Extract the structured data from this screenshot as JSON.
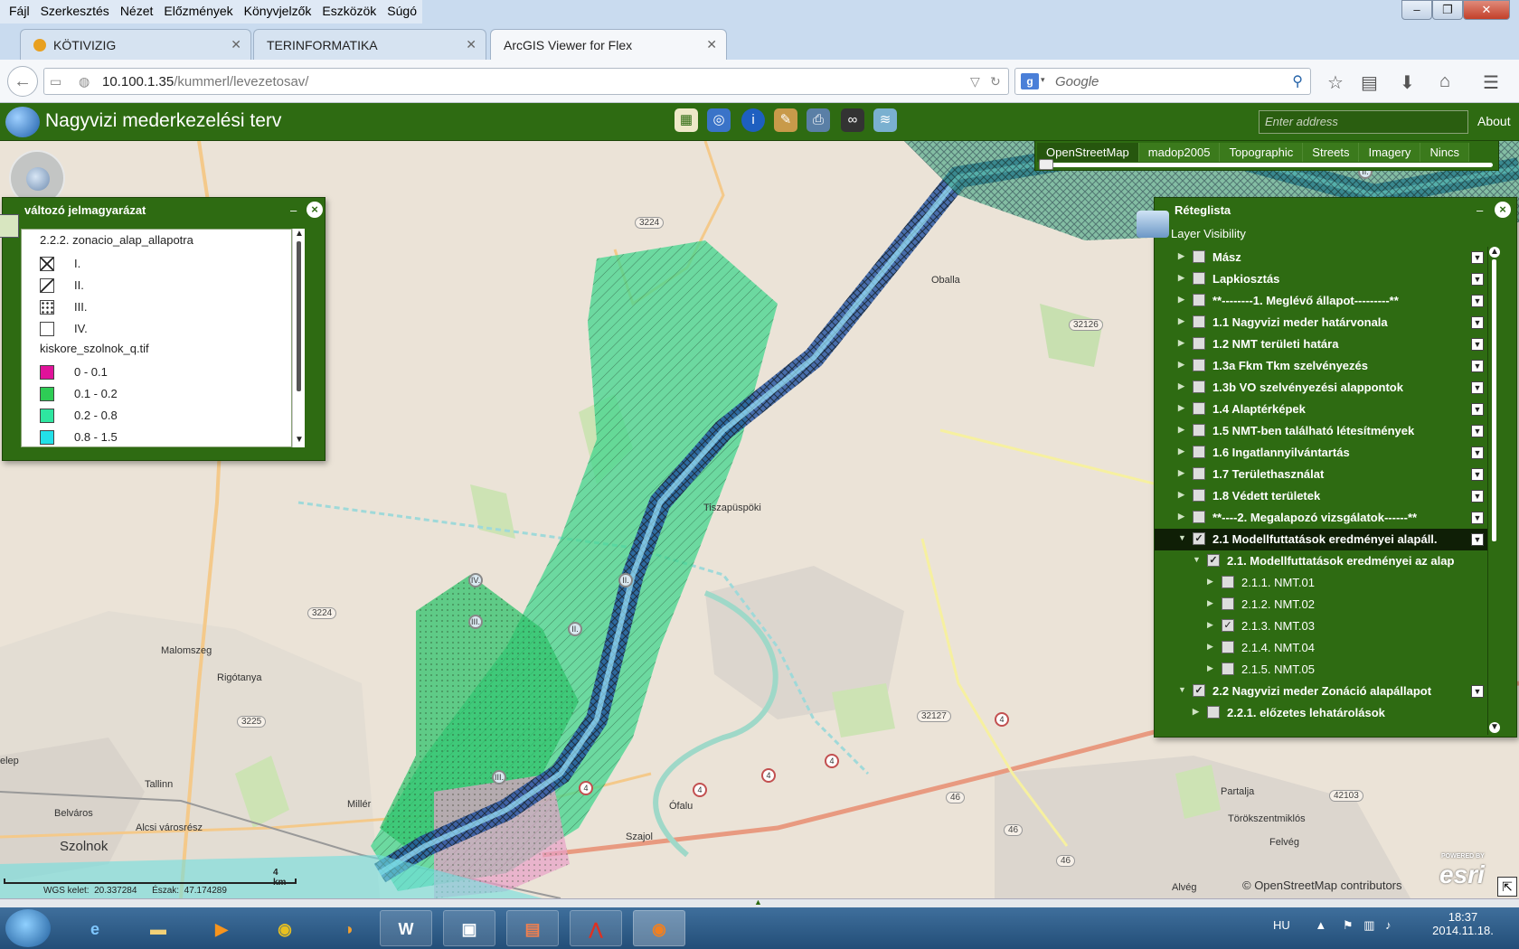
{
  "browser": {
    "menu": [
      "Fájl",
      "Szerkesztés",
      "Nézet",
      "Előzmények",
      "Könyvjelzők",
      "Eszközök",
      "Súgó"
    ],
    "tabs": [
      {
        "label": "KÖTIVIZIG"
      },
      {
        "label": "TERINFORMATIKA"
      },
      {
        "label": "ArcGIS Viewer for Flex"
      }
    ],
    "url_host": "10.100.1.35",
    "url_path": "/kummerl/levezetosav/",
    "search_placeholder": "Google"
  },
  "app": {
    "title": "Nagyvizi mederkezelési terv",
    "address_placeholder": "Enter address",
    "about": "About",
    "toolbar_icons": [
      "map-icon",
      "globe-icon",
      "info-icon",
      "palette-icon",
      "print-icon",
      "binoculars-icon",
      "layers-icon"
    ]
  },
  "basemaps": {
    "options": [
      "OpenStreetMap",
      "madop2005",
      "Topographic",
      "Streets",
      "Imagery",
      "Nincs"
    ],
    "selected": "OpenStreetMap"
  },
  "legend": {
    "title": "változó jelmagyarázat",
    "group1": "2.2.2. zonacio_alap_allapotra",
    "group1_items": [
      "I.",
      "II.",
      "III.",
      "IV."
    ],
    "group2": "kiskore_szolnok_q.tif",
    "group2_items": [
      {
        "label": "0 - 0.1",
        "color": "#e0129a"
      },
      {
        "label": "0.1 - 0.2",
        "color": "#2ecc55"
      },
      {
        "label": "0.2 - 0.8",
        "color": "#2ee6a0"
      },
      {
        "label": "0.8 - 1.5",
        "color": "#22e0e8"
      }
    ]
  },
  "layers": {
    "title": "Réteglista",
    "subtitle": "Layer Visibility",
    "rows": [
      {
        "label": "Mász",
        "level": 0,
        "checked": false
      },
      {
        "label": "Lapkiosztás",
        "level": 0,
        "checked": false
      },
      {
        "label": "**--------1. Meglévő állapot---------**",
        "level": 0,
        "checked": false
      },
      {
        "label": "1.1 Nagyvizi meder határvonala",
        "level": 0,
        "checked": false
      },
      {
        "label": "1.2 NMT területi határa",
        "level": 0,
        "checked": false
      },
      {
        "label": "1.3a Fkm Tkm szelvényezés",
        "level": 0,
        "checked": false
      },
      {
        "label": "1.3b VO szelvényezési alappontok",
        "level": 0,
        "checked": false
      },
      {
        "label": "1.4 Alaptérképek",
        "level": 0,
        "checked": false
      },
      {
        "label": "1.5 NMT-ben található létesítmények",
        "level": 0,
        "checked": false
      },
      {
        "label": "1.6 Ingatlannyilvántartás",
        "level": 0,
        "checked": false
      },
      {
        "label": "1.7 Területhasználat",
        "level": 0,
        "checked": false
      },
      {
        "label": "1.8 Védett területek",
        "level": 0,
        "checked": false
      },
      {
        "label": "**----2. Megalapozó vizsgálatok------**",
        "level": 0,
        "checked": false
      },
      {
        "label": "2.1 Modellfuttatások eredményei alapáll.",
        "level": 0,
        "checked": true
      },
      {
        "label": "2.1.   Modellfuttatások eredményei az alap",
        "level": 1,
        "checked": true
      },
      {
        "label": "2.1.1. NMT.01",
        "level": 2,
        "checked": false
      },
      {
        "label": "2.1.2. NMT.02",
        "level": 2,
        "checked": false
      },
      {
        "label": "2.1.3. NMT.03",
        "level": 2,
        "checked": true
      },
      {
        "label": "2.1.4. NMT.04",
        "level": 2,
        "checked": false
      },
      {
        "label": "2.1.5. NMT.05",
        "level": 2,
        "checked": false
      },
      {
        "label": "2.2 Nagyvizi meder Zonáció alapállapot",
        "level": 0,
        "checked": true
      },
      {
        "label": "2.2.1. előzetes lehatárolások",
        "level": 1,
        "checked": false
      }
    ]
  },
  "map": {
    "places": [
      "Oballa",
      "Tiszapüspöki",
      "Malomszeg",
      "Rigótanya",
      "Tallinn",
      "Belváros",
      "Alcsi városrész",
      "Szolnok",
      "Millér",
      "Szajol",
      "Ófalu",
      "Partalja",
      "Törökszentmiklós",
      "Felvég",
      "Alvég",
      "elep"
    ],
    "roads": [
      "3224",
      "3224",
      "32126",
      "3225",
      "32127",
      "42103",
      "46",
      "46",
      "46",
      "4",
      "4",
      "4",
      "4",
      "4"
    ],
    "zones": [
      "IV.",
      "III.",
      "II.",
      "II.",
      "III.",
      "II."
    ],
    "scale": "4 km",
    "coords": "WGS kelet:  20.337284      Észak:  47.174289",
    "attribution": "© OpenStreetMap contributors",
    "esri_powered": "POWERED BY",
    "esri": "esri"
  },
  "taskbar": {
    "lang": "HU",
    "time": "18:37",
    "date": "2014.11.18."
  },
  "colors": {
    "app_green": "#2e6b12",
    "selected_row": "#0f1f06"
  }
}
